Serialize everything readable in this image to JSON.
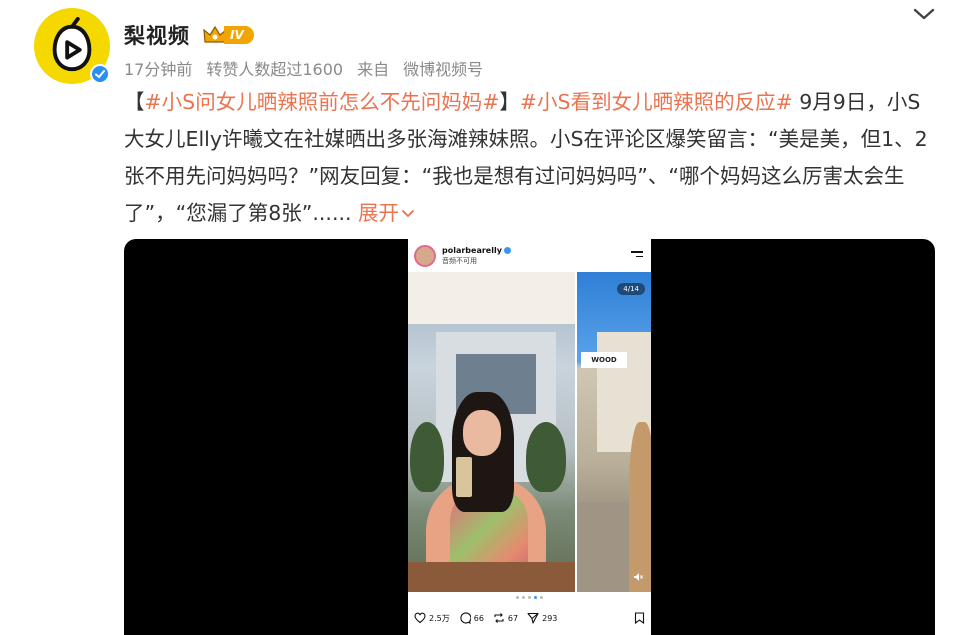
{
  "author": {
    "name": "梨视频",
    "level": "IV",
    "meta_time": "17分钟前",
    "meta_reposts": "转赞人数超过1600",
    "meta_from": "来自",
    "meta_source": "微博视频号"
  },
  "post": {
    "bracket_open": "【",
    "tag1": "#小S问女儿晒辣照前怎么不先问妈妈#",
    "bracket_close": "】",
    "tag2": "#小S看到女儿晒辣照的反应#",
    "body": " 9月9日，小S大女儿Elly许曦文在社媒晒出多张海滩辣妹照。小S在评论区爆笑留言：“美是美，但1、2张不用先问妈妈吗？”网友回复：“我也是想有过问妈妈吗”、“哪个妈妈这么厉害太会生了”，“您漏了第8张”......",
    "expand_label": "展开"
  },
  "instagram": {
    "username": "polarbearelly",
    "subtitle": "音频不可用",
    "page_indicator": "4/14",
    "sign_text": "WOOD",
    "likes": "2.5万",
    "comments": "66",
    "reposts": "67",
    "shares": "293"
  },
  "colors": {
    "accent": "#eb7350",
    "avatar_bg": "#f5d800",
    "verified": "#2b8ef0",
    "badge": "#f2a400"
  }
}
